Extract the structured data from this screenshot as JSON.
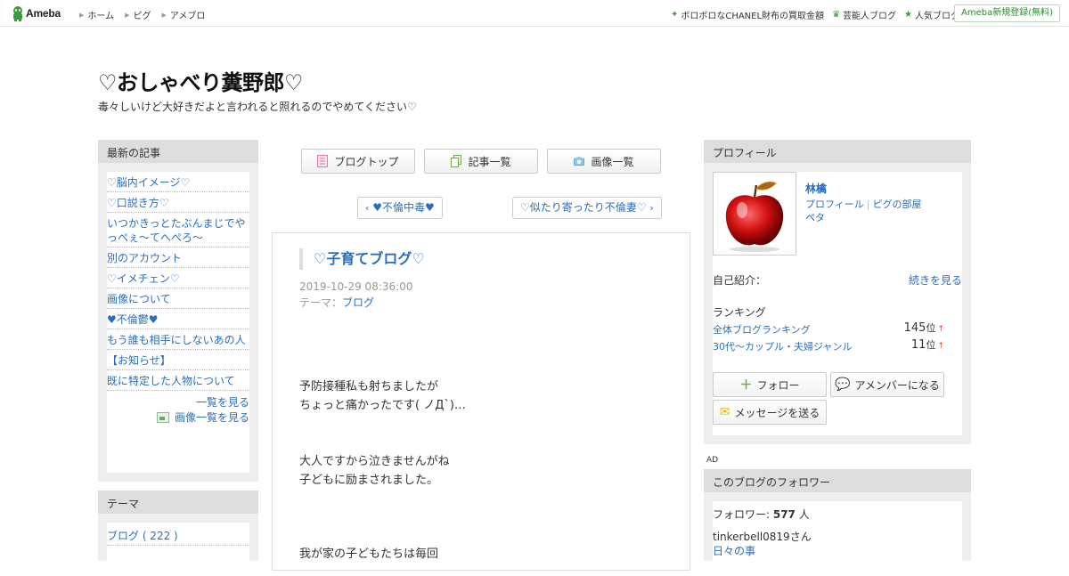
{
  "topbar": {
    "logo_text": "Ameba",
    "nav": [
      "ホーム",
      "ピグ",
      "アメブロ"
    ],
    "right_links": [
      {
        "label": "ボロボロなCHANEL財布の買取金額",
        "icon": "sparkle-icon"
      },
      {
        "label": "芸能人ブログ",
        "icon": "crown-icon"
      },
      {
        "label": "人気ブログ",
        "icon": "star-icon"
      }
    ],
    "register_label": "Ameba新規登録(無料)"
  },
  "header": {
    "title": "♡おしゃべり糞野郎♡",
    "description": "毒々しいけど大好きだよと言われると照れるのでやめてください♡"
  },
  "recent": {
    "heading": "最新の記事",
    "items": [
      "♡脳内イメージ♡",
      "♡口説き方♡",
      "いつかきっとたぶんまじでやっぺぇ～てへぺろ～",
      "別のアカウント",
      "♡イメチェン♡",
      "画像について",
      "♥不倫鬱♥",
      "もう誰も相手にしないあの人",
      "【お知らせ】",
      "既に特定した人物について"
    ],
    "list_more": "一覧を見る",
    "image_more": "画像一覧を見る"
  },
  "theme": {
    "heading": "テーマ",
    "items": [
      "ブログ ( 222 )"
    ]
  },
  "nav_buttons": {
    "top": "ブログトップ",
    "list": "記事一覧",
    "images": "画像一覧"
  },
  "pager": {
    "prev": "♥不倫中毒♥",
    "next": "♡似たり寄ったり不倫妻♡"
  },
  "article": {
    "title": "♡子育てブログ♡",
    "date": "2019-10-29 08:36:00",
    "theme_label": "テーマ：",
    "theme_value": "ブログ",
    "paragraphs": [
      [
        "予防接種私も射ちましたが",
        "ちょっと痛かったです( ノД`)…"
      ],
      [
        "大人ですから泣きませんがね",
        "子どもに励まされました。"
      ],
      [
        "我が家の子どもたちは毎回"
      ]
    ]
  },
  "profile": {
    "heading": "プロフィール",
    "name": "林檎",
    "link_profile": "プロフィール",
    "link_pig": "ピグの部屋",
    "link_peta": "ペタ",
    "intro_label": "自己紹介：",
    "intro_more": "続きを見る",
    "ranking_heading": "ランキング",
    "rankings": [
      {
        "label": "全体ブログランキング",
        "value": "145",
        "unit": "位",
        "trend": "↑"
      },
      {
        "label": "30代〜カップル・夫婦ジャンル",
        "value": "11",
        "unit": "位",
        "trend": "↑"
      }
    ],
    "follow_label": "フォロー",
    "member_label": "アメンバーになる",
    "message_label": "メッセージを送る"
  },
  "ad_label": "AD",
  "followers": {
    "heading": "このブログのフォロワー",
    "count_label": "フォロワー: ",
    "count_value": "577",
    "count_unit": " 人",
    "user": "tinkerbell0819さん",
    "user_blog": "日々の事"
  },
  "colors": {
    "link": "#2a6ebb",
    "brand_green": "#3c9a3c",
    "panel_bg": "#eeeeee",
    "panel_head": "#dddddd"
  }
}
